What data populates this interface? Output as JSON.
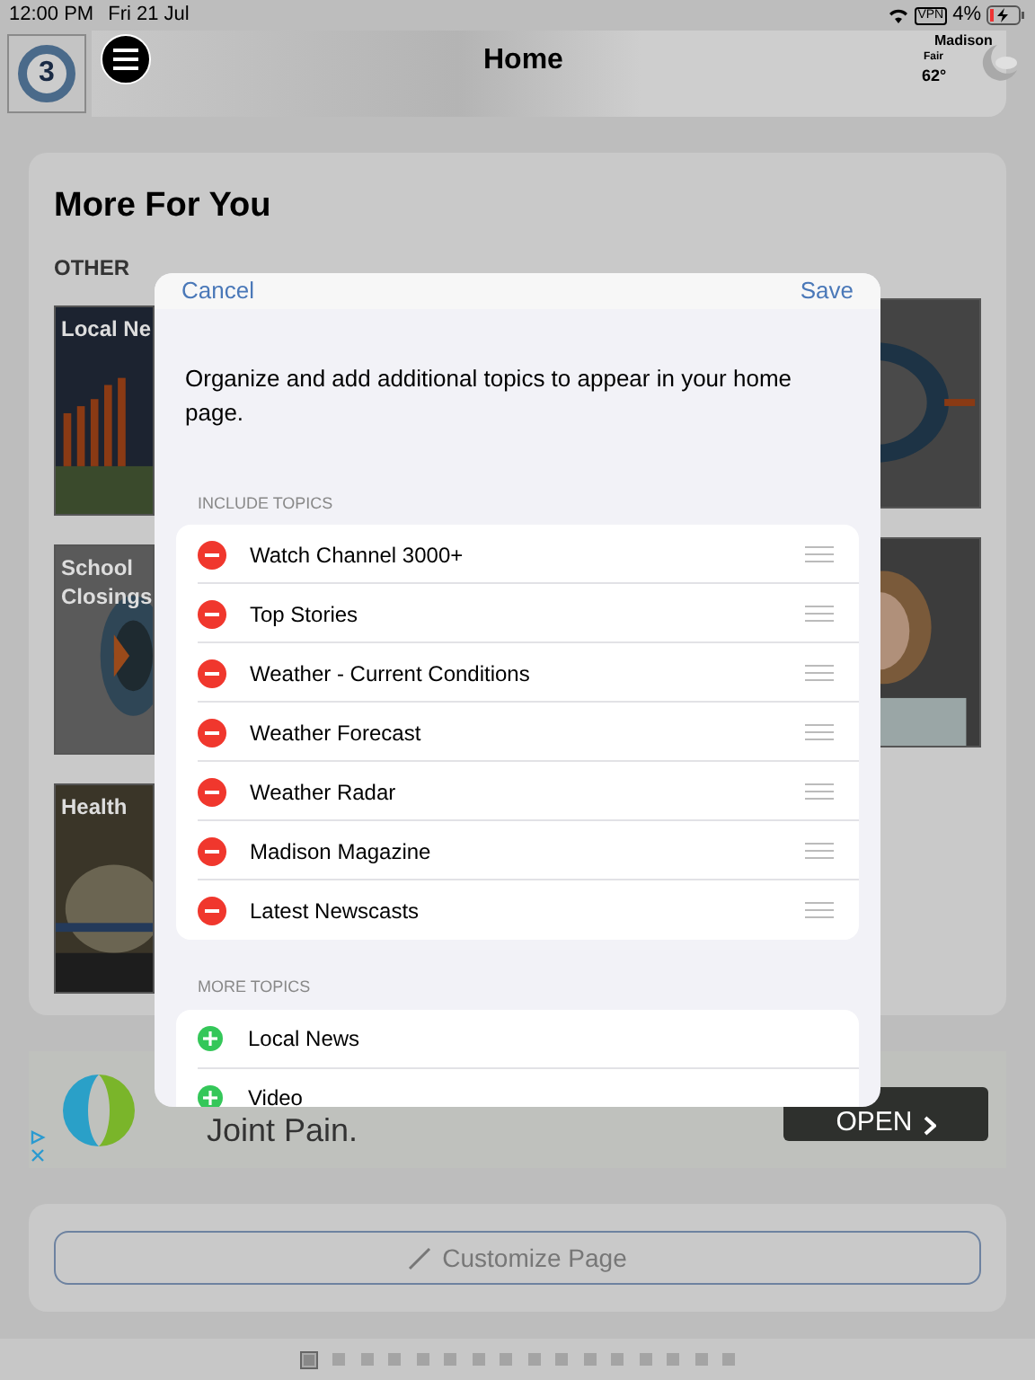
{
  "status_bar": {
    "time": "12:00 PM",
    "date": "Fri 21 Jul",
    "vpn": "VPN",
    "battery": "4%"
  },
  "header": {
    "logo_text": "3",
    "title": "Home",
    "weather": {
      "city": "Madison",
      "condition": "Fair",
      "temp": "62°"
    }
  },
  "section": {
    "title": "More For You",
    "subtitle": "OTHER",
    "tiles": [
      {
        "title": "Local Ne"
      },
      {
        "title": "School Closings"
      },
      {
        "title": "Health"
      }
    ]
  },
  "dialog": {
    "cancel": "Cancel",
    "save": "Save",
    "intro": "Organize and add additional topics to appear in your home page.",
    "groups": [
      {
        "header": "INCLUDE TOPICS",
        "topics": [
          {
            "kind": "remove",
            "label": "Watch Channel 3000+"
          },
          {
            "kind": "remove",
            "label": "Top Stories"
          },
          {
            "kind": "remove",
            "label": "Weather - Current Conditions"
          },
          {
            "kind": "remove",
            "label": "Weather Forecast"
          },
          {
            "kind": "remove",
            "label": "Weather Radar"
          },
          {
            "kind": "remove",
            "label": "Madison Magazine"
          },
          {
            "kind": "remove",
            "label": "Latest Newscasts"
          }
        ]
      },
      {
        "header": "MORE TOPICS",
        "topics": [
          {
            "kind": "add",
            "label": "Local News"
          },
          {
            "kind": "add",
            "label": "Video"
          }
        ]
      }
    ]
  },
  "ad": {
    "text": "Joint Pain.",
    "button": "OPEN"
  },
  "customize_button": "Customize Page",
  "pages": [
    {
      "selected": true
    },
    {
      "selected": false
    },
    {
      "selected": false
    },
    {
      "selected": false
    },
    {
      "selected": false
    },
    {
      "selected": false
    },
    {
      "selected": false
    },
    {
      "selected": false
    },
    {
      "selected": false
    },
    {
      "selected": false
    },
    {
      "selected": false
    },
    {
      "selected": false
    },
    {
      "selected": false
    },
    {
      "selected": false
    },
    {
      "selected": false
    },
    {
      "selected": false
    }
  ]
}
